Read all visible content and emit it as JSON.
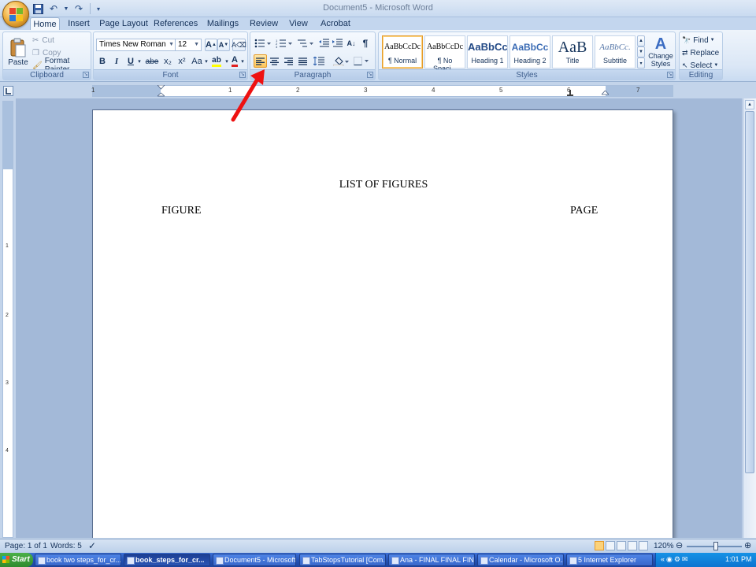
{
  "window": {
    "title": "Document5 - Microsoft Word"
  },
  "tabs": [
    "Home",
    "Insert",
    "Page Layout",
    "References",
    "Mailings",
    "Review",
    "View",
    "Acrobat"
  ],
  "clipboard": {
    "paste": "Paste",
    "cut": "Cut",
    "copy": "Copy",
    "format_painter": "Format Painter",
    "label": "Clipboard"
  },
  "font": {
    "name": "Times New Roman",
    "size": "12",
    "label": "Font",
    "bold": "B",
    "italic": "I",
    "underline": "U",
    "strike": "abe",
    "subscript": "x₂",
    "superscript": "x²",
    "change_case": "Aa",
    "grow": "A",
    "shrink": "A",
    "font_color": "A"
  },
  "paragraph": {
    "label": "Paragraph"
  },
  "styles": {
    "label": "Styles",
    "items": [
      {
        "sample": "AaBbCcDc",
        "name": "¶ Normal"
      },
      {
        "sample": "AaBbCcDc",
        "name": "¶ No Spaci..."
      },
      {
        "sample": "AaBbCc",
        "name": "Heading 1"
      },
      {
        "sample": "AaBbCc",
        "name": "Heading 2"
      },
      {
        "sample": "AaB",
        "name": "Title"
      },
      {
        "sample": "AaBbCc.",
        "name": "Subtitle"
      }
    ],
    "change_styles": "Change Styles"
  },
  "editing": {
    "label": "Editing",
    "find": "Find",
    "replace": "Replace",
    "select": "Select"
  },
  "ruler": {
    "numbers": [
      "1",
      "1",
      "2",
      "3",
      "4",
      "5",
      "6",
      "7"
    ],
    "vnumbers": [
      "1",
      "2",
      "3",
      "4"
    ]
  },
  "document": {
    "heading": "LIST OF FIGURES",
    "left_col": "FIGURE",
    "right_col": "PAGE"
  },
  "status": {
    "page": "Page: 1 of 1",
    "words": "Words: 5",
    "zoom": "120%"
  },
  "taskbar": {
    "start": "Start",
    "tasks": [
      "book two steps_for_cr...",
      "book_steps_for_cr...",
      "Document5 - Microsoft...",
      "TabStopsTutorial [Com...",
      "Ana - FINAL FINAL FIN...",
      "Calendar - Microsoft O...",
      "5 Internet Explorer"
    ],
    "clock": "1:01 PM"
  },
  "colors": {
    "accent": "#e59b2b",
    "ribbon": "#dbe7f6",
    "arrow": "#ee1111"
  }
}
